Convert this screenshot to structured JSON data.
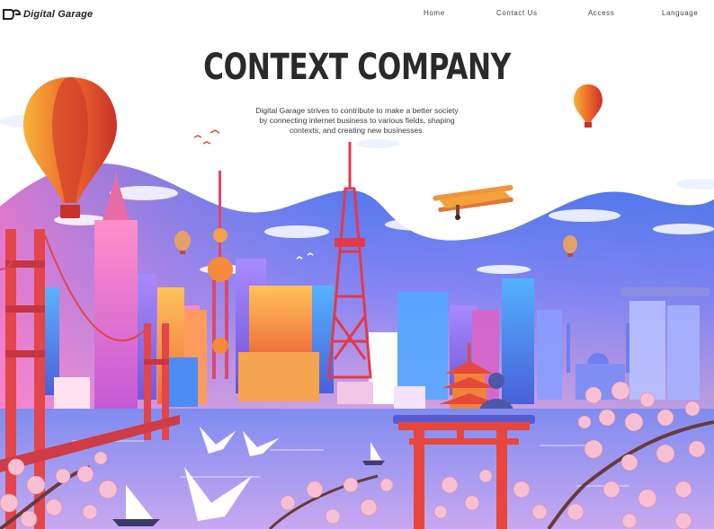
{
  "brand": {
    "name": "Digital Garage",
    "logo_icon": "dg-logo-icon"
  },
  "nav": {
    "home": "Home",
    "contact": "Contact Us",
    "access": "Access",
    "language": "Language"
  },
  "hero": {
    "title": "CONTEXT COMPANY",
    "description_line1": "Digital Garage strives to contribute to make a better society",
    "description_line2": "by connecting internet business to various fields, shaping",
    "description_line3": "contexts, and creating new businesses."
  },
  "colors": {
    "sky_wave": "#3a6fe0",
    "accent_red": "#e23a3a",
    "sakura": "#f7b6c8",
    "water": "#b69ae8"
  }
}
